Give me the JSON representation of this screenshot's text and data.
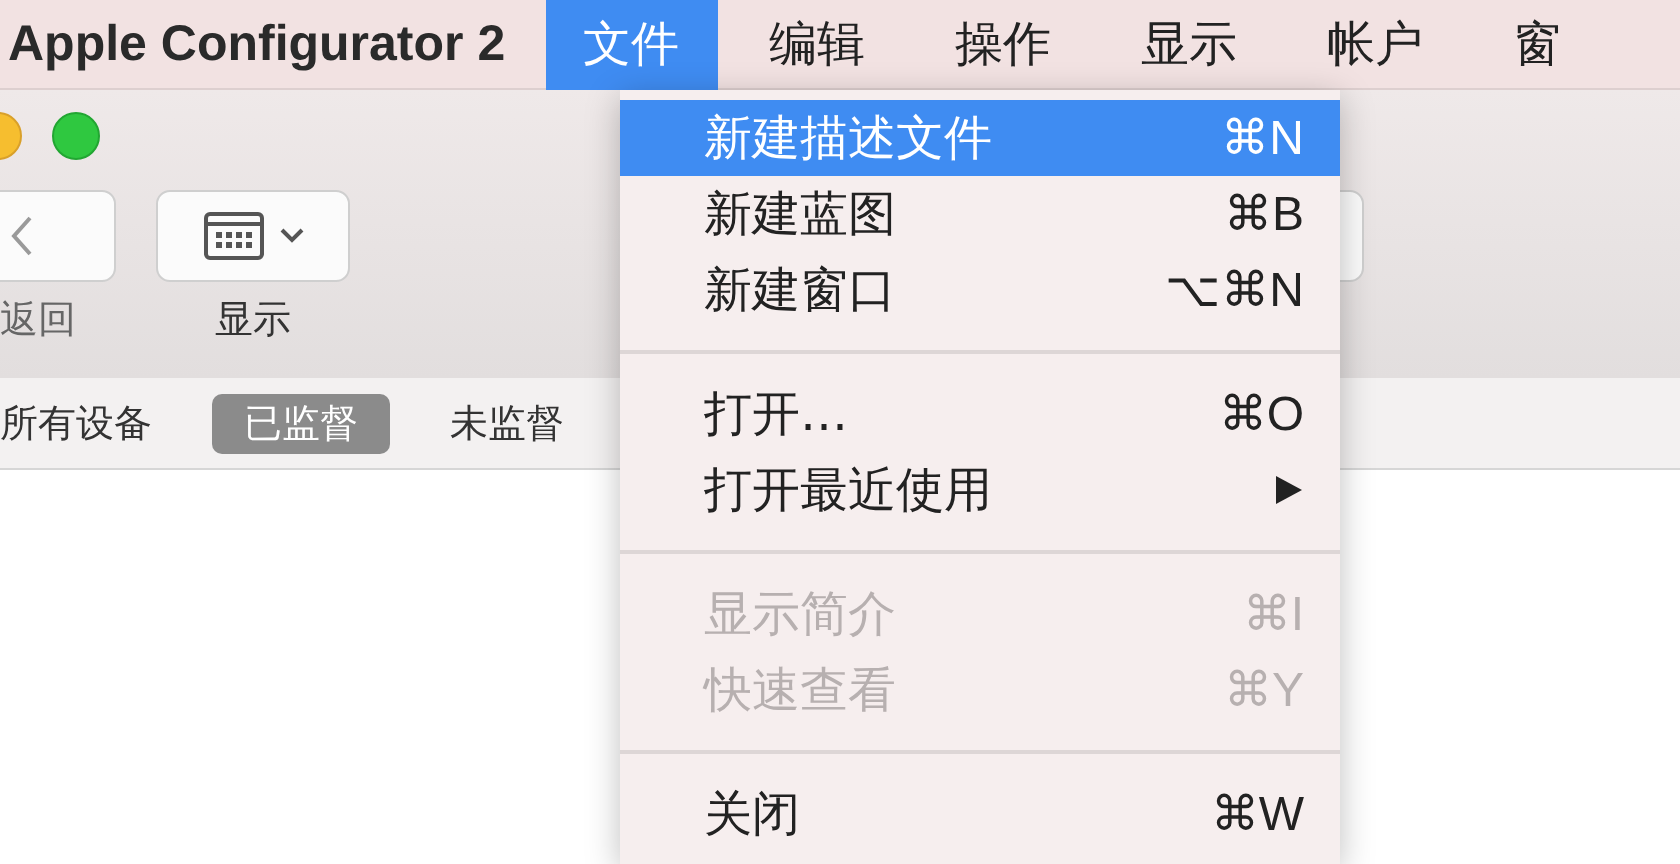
{
  "menu_bar": {
    "app_name": "Apple Configurator 2",
    "menus": [
      {
        "label": "文件",
        "selected": true
      },
      {
        "label": "编辑",
        "selected": false
      },
      {
        "label": "操作",
        "selected": false
      },
      {
        "label": "显示",
        "selected": false
      },
      {
        "label": "帐户",
        "selected": false
      },
      {
        "label": "窗",
        "selected": false
      }
    ]
  },
  "toolbar": {
    "buttons": [
      {
        "kind": "back",
        "label": "返回"
      },
      {
        "kind": "view",
        "label": "显示"
      },
      {
        "kind": "plain"
      }
    ]
  },
  "filter_tabs": [
    {
      "label": "所有设备",
      "selected": false
    },
    {
      "label": "已监督",
      "selected": true
    },
    {
      "label": "未监督",
      "selected": false
    }
  ],
  "dropdown": {
    "sections": [
      [
        {
          "label": "新建描述文件",
          "shortcut": "⌘N",
          "selected": true,
          "disabled": false
        },
        {
          "label": "新建蓝图",
          "shortcut": "⌘B",
          "selected": false,
          "disabled": false
        },
        {
          "label": "新建窗口",
          "shortcut": "⌥⌘N",
          "selected": false,
          "disabled": false
        }
      ],
      [
        {
          "label": "打开…",
          "shortcut": "⌘O",
          "selected": false,
          "disabled": false
        },
        {
          "label": "打开最近使用",
          "submenu": true,
          "selected": false,
          "disabled": false
        }
      ],
      [
        {
          "label": "显示简介",
          "shortcut": "⌘I",
          "selected": false,
          "disabled": true
        },
        {
          "label": "快速查看",
          "shortcut": "⌘Y",
          "selected": false,
          "disabled": true
        }
      ],
      [
        {
          "label": "关闭",
          "shortcut": "⌘W",
          "selected": false,
          "disabled": false
        }
      ]
    ]
  }
}
